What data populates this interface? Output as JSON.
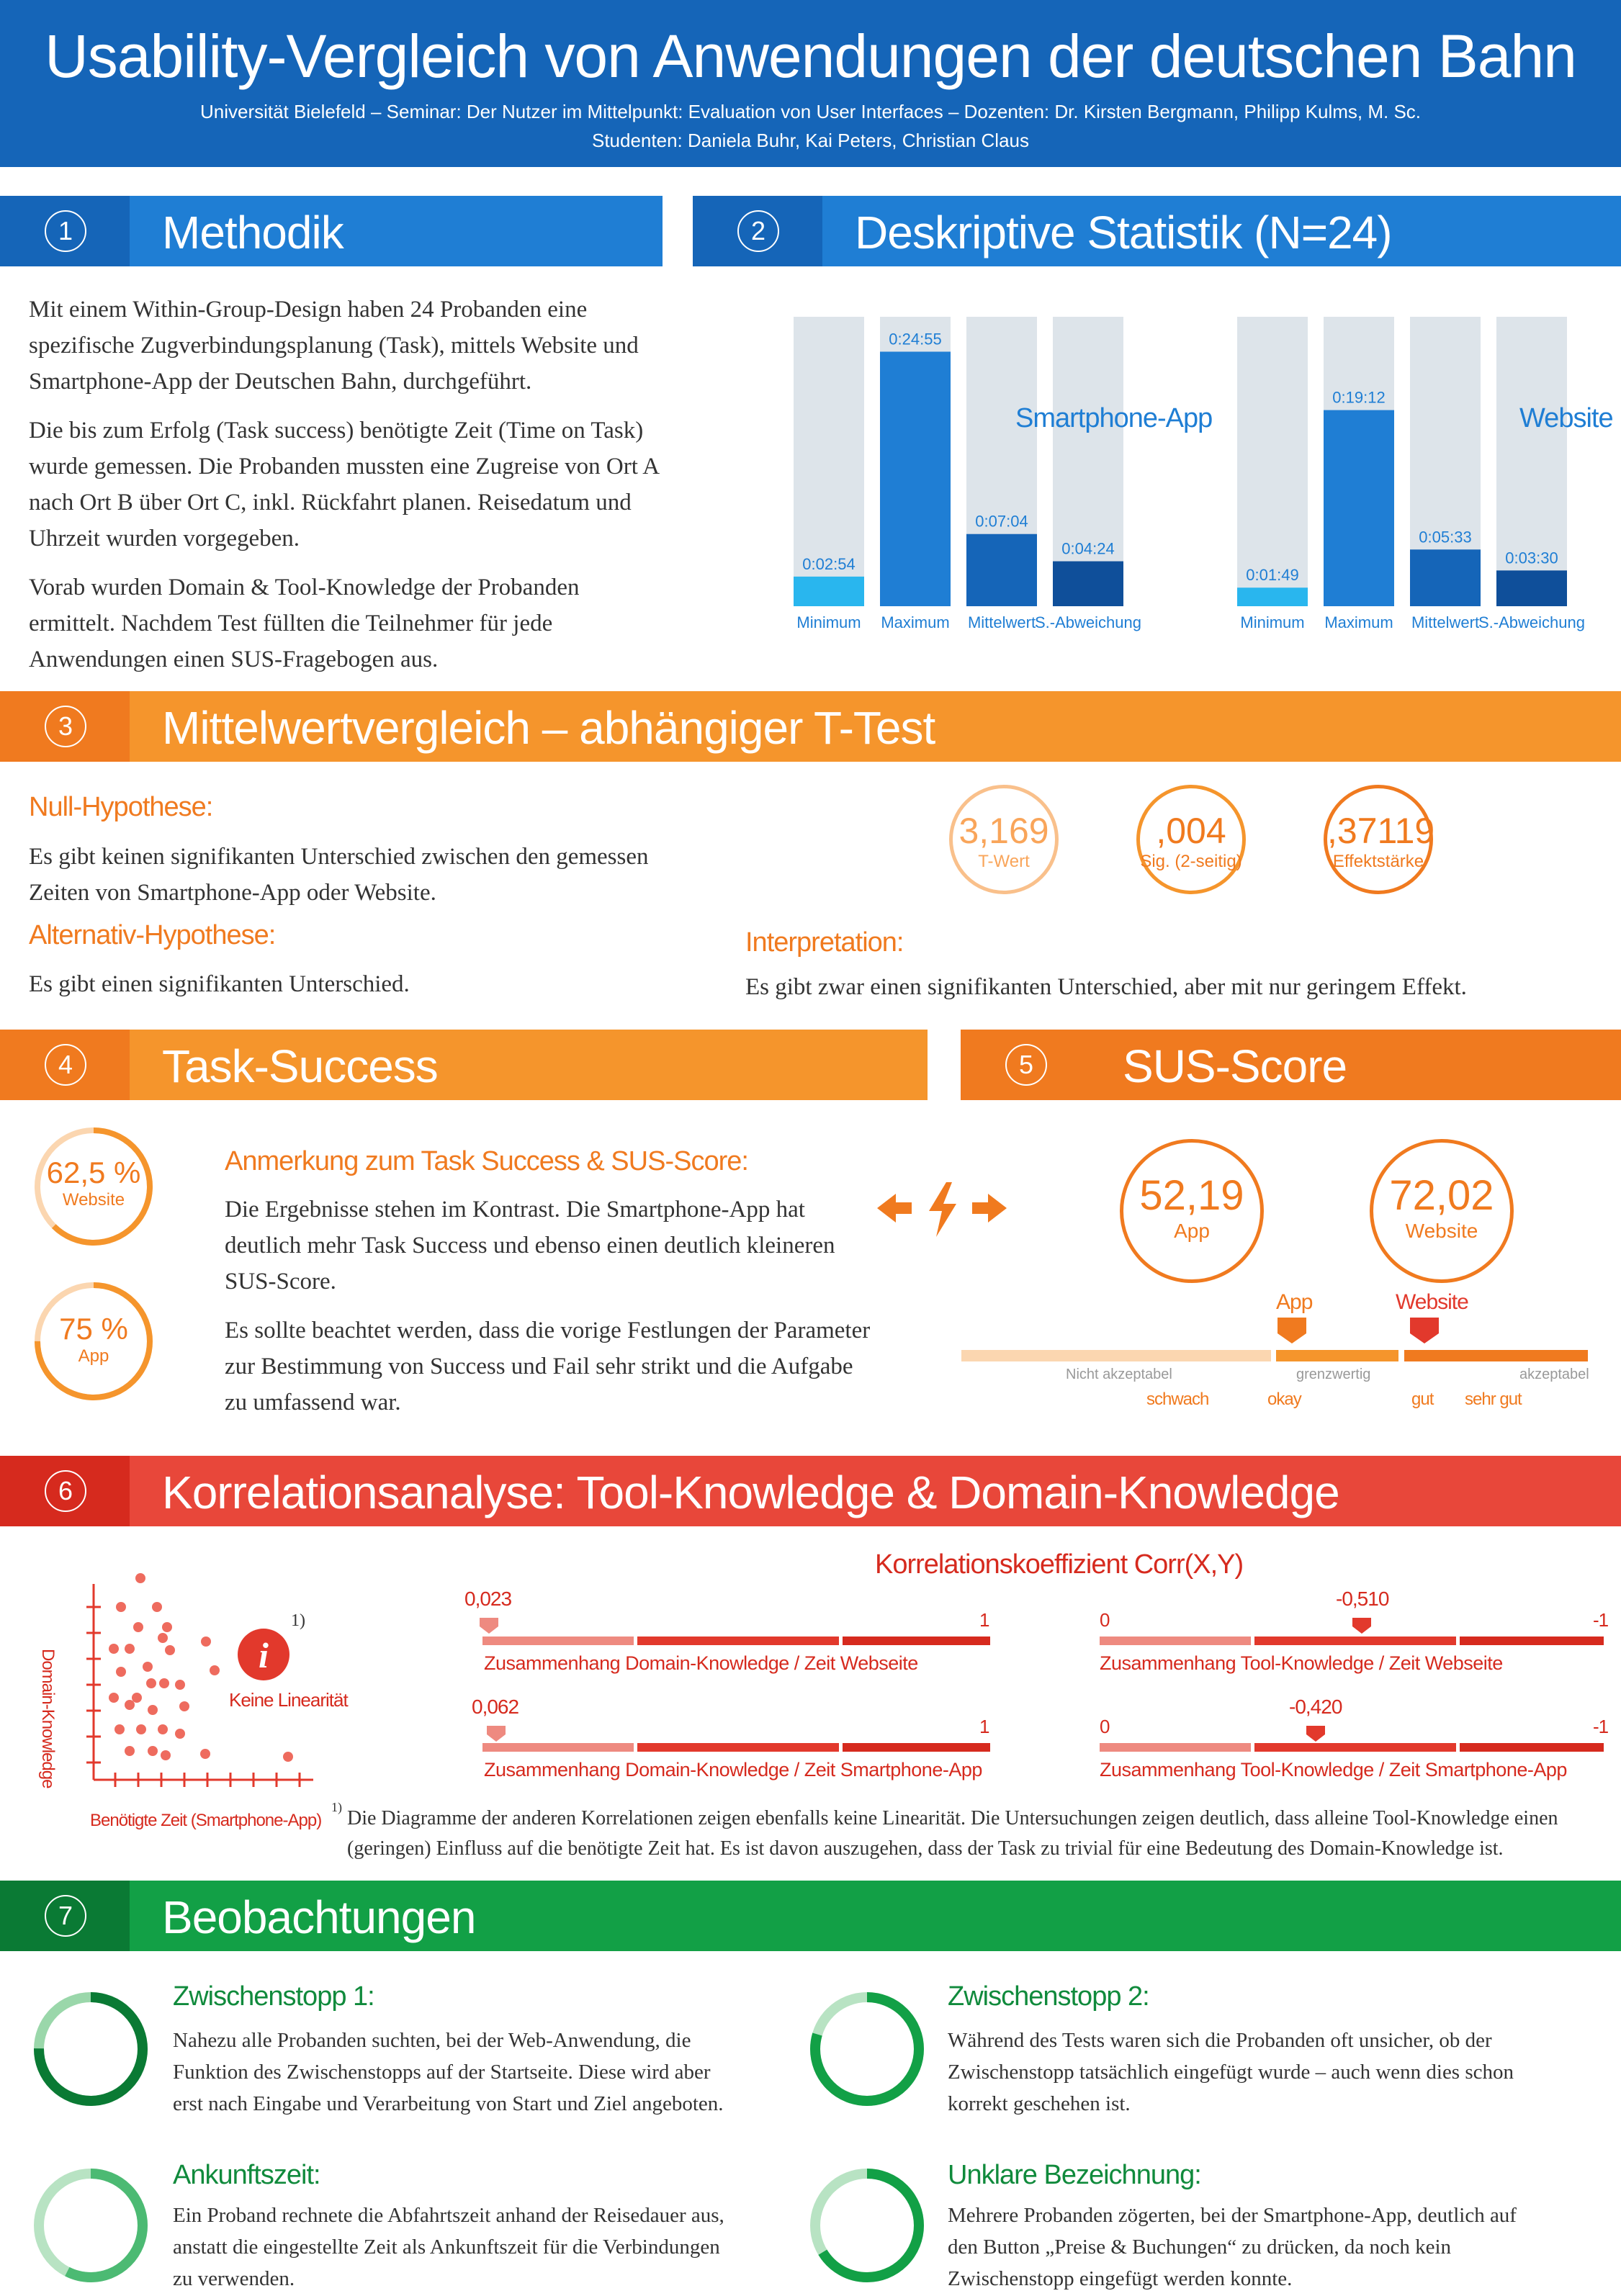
{
  "header": {
    "title": "Usability-Vergleich von Anwendungen der deutschen Bahn",
    "line1": "Universität Bielefeld – Seminar: Der Nutzer im Mittelpunkt: Evaluation von User Interfaces – Dozenten: Dr. Kirsten Bergmann, Philipp Kulms, M. Sc.",
    "line2": "Studenten: Daniela Buhr, Kai Peters, Christian Claus"
  },
  "colors": {
    "blue": "#1565b8",
    "orange": "#f5952c",
    "red": "#e2392c",
    "green": "#12a046"
  },
  "s1": {
    "num": "1",
    "title": "Methodik",
    "p1": "Mit einem Within-Group-Design haben 24 Probanden eine spezifische Zugverbindungsplanung (Task), mittels Website und Smartphone-App der Deutschen Bahn, durchgeführt.",
    "p2": "Die bis zum Erfolg (Task success) benötigte Zeit (Time on Task) wurde gemessen. Die Probanden mussten eine Zugreise von Ort A nach Ort B über Ort C, inkl. Rückfahrt planen. Reisedatum und Uhrzeit wurden vorgegeben.",
    "p3": "Vorab wurden Domain & Tool-Knowledge der Probanden ermittelt. Nachdem Test füllten die Teilnehmer für jede Anwendungen einen SUS-Fragebogen aus."
  },
  "s2": {
    "num": "2",
    "title": "Deskriptive Statistik (N=24)",
    "app_label": "Smartphone-App",
    "web_label": "Website",
    "categories": [
      "Minimum",
      "Maximum",
      "Mittelwert",
      "S.-Abweichung"
    ],
    "app_values": [
      "0:02:54",
      "0:24:55",
      "0:07:04",
      "0:04:24"
    ],
    "web_values": [
      "0:01:49",
      "0:19:12",
      "0:05:33",
      "0:03:30"
    ]
  },
  "chart_data": {
    "type": "bar",
    "categories": [
      "Minimum",
      "Maximum",
      "Mittelwert",
      "S.-Abweichung"
    ],
    "series": [
      {
        "name": "Smartphone-App",
        "values": [
          174,
          1495,
          424,
          264
        ]
      },
      {
        "name": "Website",
        "values": [
          109,
          1152,
          333,
          210
        ]
      }
    ],
    "ylim": [
      0,
      1700
    ]
  },
  "s3": {
    "num": "3",
    "title": "Mittelwertvergleich – abhängiger T-Test",
    "null_h": "Null-Hypothese:",
    "null_t": "Es gibt keinen signifikanten Unterschied zwischen den gemessen Zeiten von Smartphone-App oder Website.",
    "alt_h": "Alternativ-Hypothese:",
    "alt_t": "Es gibt einen signifikanten Unterschied.",
    "int_h": "Interpretation:",
    "int_t": "Es gibt zwar einen signifikanten Unterschied, aber mit nur geringem Effekt.",
    "stats": [
      {
        "value": "3,169",
        "caption": "T-Wert"
      },
      {
        "value": ",004",
        "caption": "Sig. (2-seitig)"
      },
      {
        "value": ",37119",
        "caption": "Effektstärke"
      }
    ]
  },
  "s4": {
    "num": "4",
    "title": "Task-Success",
    "web_value": "62,5 %",
    "web_caption": "Website",
    "web_fraction": 0.625,
    "app_value": "75 %",
    "app_caption": "App",
    "app_fraction": 0.75,
    "note_h": "Anmerkung zum Task Success & SUS-Score:",
    "note_p1": "Die Ergebnisse stehen im Kontrast. Die Smartphone-App hat deutlich mehr Task Success und ebenso einen deutlich kleineren SUS-Score.",
    "note_p2": "Es sollte beachtet werden, dass die vorige Festlungen der Parameter zur Bestimmung von Success und Fail sehr strikt und die Aufgabe zu umfassend war."
  },
  "s5": {
    "num": "5",
    "title": "SUS-Score",
    "app_value": "52,19",
    "app_caption": "App",
    "web_value": "72,02",
    "web_caption": "Website",
    "marker_app": "App",
    "marker_web": "Website",
    "scale_left": "Nicht akzeptabel",
    "scale_mid": "grenzwertig",
    "scale_right": "akzeptabel",
    "grades": [
      "schwach",
      "okay",
      "gut",
      "sehr gut"
    ]
  },
  "s6": {
    "num": "6",
    "title": "Korrelationsanalyse: Tool-Knowledge & Domain-Knowledge",
    "y_axis": "Domain-Knowledge",
    "x_axis": "Benötigte Zeit (Smartphone-App)",
    "info_label": "Keine Linearität",
    "footnote_mark": "1)",
    "corr_title": "Korrelationskoeffizient Corr(X,Y)",
    "rows": [
      {
        "value": "0,023",
        "start": "",
        "end": "1",
        "label": "Zusammenhang Domain-Knowledge / Zeit Webseite"
      },
      {
        "value": "0,062",
        "start": "",
        "end": "1",
        "label": "Zusammenhang Domain-Knowledge / Zeit Smartphone-App"
      },
      {
        "value": "-0,510",
        "start": "0",
        "end": "-1",
        "label": "Zusammenhang Tool-Knowledge / Zeit Webseite"
      },
      {
        "value": "-0,420",
        "start": "0",
        "end": "-1",
        "label": "Zusammenhang Tool-Knowledge / Zeit Smartphone-App"
      }
    ],
    "footnote": "Die Diagramme der anderen Korrelationen zeigen ebenfalls keine Linearität. Die Untersuchungen zeigen deutlich, dass alleine Tool-Knowledge einen (geringen) Einfluss auf die benötigte Zeit hat. Es ist davon auszugehen, dass der Task zu trivial für eine Bedeutung des Domain-Knowledge ist."
  },
  "s7": {
    "num": "7",
    "title": "Beobachtungen",
    "items": [
      {
        "h": "Zwischenstopp 1:",
        "t": "Nahezu alle Probanden suchten, bei der Web-Anwendung, die Funktion des Zwischenstopps auf der Startseite. Diese wird aber erst nach Eingabe und Verarbeitung von Start und Ziel angeboten."
      },
      {
        "h": "Zwischenstopp 2:",
        "t": "Während des Tests waren sich die Probanden oft unsicher, ob der Zwischenstopp tatsächlich eingefügt wurde – auch wenn dies schon korrekt geschehen ist."
      },
      {
        "h": "Ankunftszeit:",
        "t": "Ein Proband rechnete die Abfahrtszeit anhand der Reisedauer aus, anstatt die eingestellte Zeit als Ankunftszeit für die Verbindungen zu verwenden."
      },
      {
        "h": "Unklare Bezeichnung:",
        "t": "Mehrere Probanden zögerten, bei der Smartphone-App, deutlich auf den Button „Preise & Buchungen“ zu drücken, da noch kein Zwischenstopp eingefügt werden konnte."
      }
    ]
  }
}
